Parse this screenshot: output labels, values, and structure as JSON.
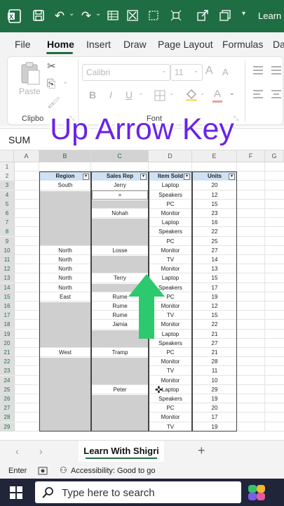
{
  "titlebar": {
    "title": "Learn W"
  },
  "menu": {
    "items": [
      "File",
      "Home",
      "Insert",
      "Draw",
      "Page Layout",
      "Formulas",
      "Da"
    ]
  },
  "ribbon": {
    "paste_label": "Paste",
    "clipboard_label": "Clipbo",
    "font_label": "Font",
    "font_name": "Calibri",
    "font_size": "11",
    "bold": "B",
    "italic": "I",
    "underline": "U",
    "grow_font": "A",
    "shrink_font": "A",
    "font_color": "A"
  },
  "formulabar": {
    "name_box": "SUM"
  },
  "overlay": {
    "text": "Up Arrow Key"
  },
  "columns": [
    "A",
    "B",
    "C",
    "D",
    "E",
    "F",
    "G"
  ],
  "rows": [
    "1",
    "2",
    "3",
    "4",
    "5",
    "6",
    "7",
    "8",
    "9",
    "10",
    "11",
    "12",
    "13",
    "14",
    "15",
    "16",
    "17",
    "18",
    "19",
    "20",
    "21",
    "22",
    "23",
    "24",
    "25",
    "26",
    "27",
    "28",
    "29"
  ],
  "table": {
    "headers": [
      "Region",
      "Sales Rep",
      "Item Sold",
      "Units"
    ],
    "region": {
      "3": "South",
      "10": "North",
      "11": "North",
      "12": "North",
      "13": "North",
      "14": "North",
      "15": "East",
      "21": "West"
    },
    "sales_rep": {
      "3": "Jerry",
      "4": "=",
      "6": "Nohah",
      "10": "Losse",
      "13": "Terry",
      "15": "Rume",
      "16": "Rume",
      "17": "Rume",
      "18": "Jamia",
      "21": "Tramp",
      "25": "Peter"
    },
    "item": [
      "Laptop",
      "Speakers",
      "PC",
      "Monitor",
      "Laptop",
      "Speakers",
      "PC",
      "Monitor",
      "TV",
      "Monitor",
      "Laptop",
      "Speakers",
      "PC",
      "Monitor",
      "TV",
      "Monitor",
      "Laptop",
      "Speakers",
      "PC",
      "Monitor",
      "TV",
      "Monitor",
      "Laptop",
      "Speakers",
      "PC",
      "Monitor",
      "TV"
    ],
    "units": [
      "20",
      "12",
      "15",
      "23",
      "16",
      "22",
      "25",
      "27",
      "14",
      "13",
      "15",
      "17",
      "19",
      "12",
      "15",
      "22",
      "21",
      "27",
      "21",
      "28",
      "11",
      "10",
      "29",
      "19",
      "20",
      "17",
      "19"
    ]
  },
  "sheet": {
    "tab": "Learn With Shigri"
  },
  "status": {
    "mode": "Enter",
    "accessibility": "Accessibility: Good to go"
  },
  "taskbar": {
    "search_placeholder": "Type here to search"
  }
}
